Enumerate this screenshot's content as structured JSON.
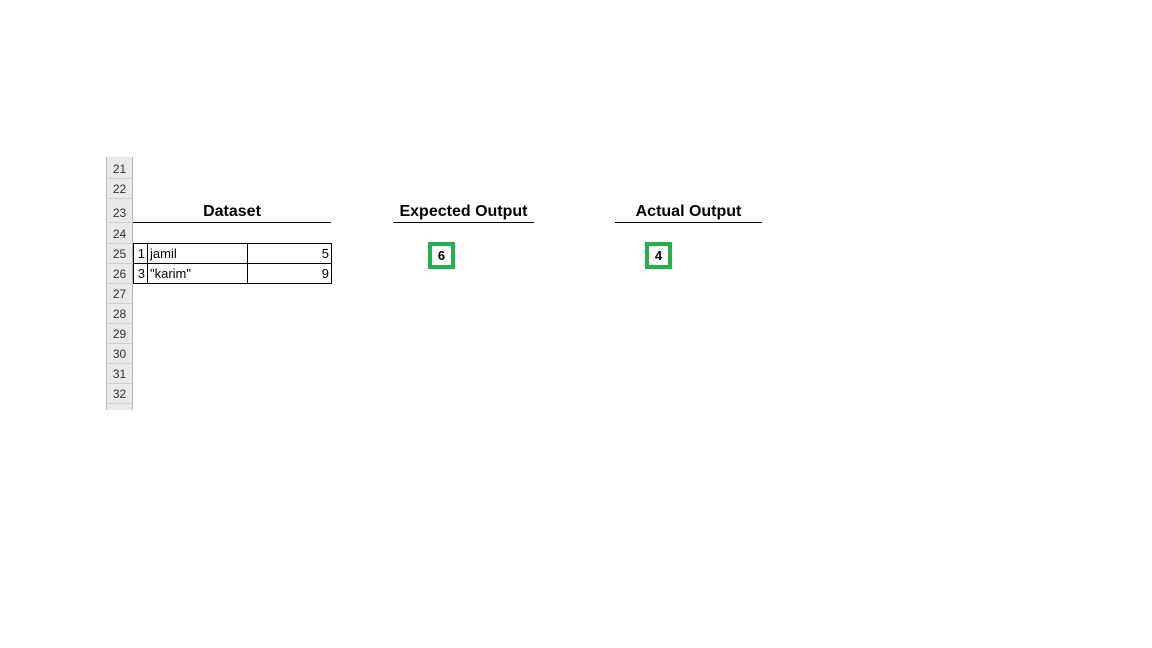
{
  "row_numbers": [
    "21",
    "22",
    "23",
    "24",
    "25",
    "26",
    "27",
    "28",
    "29",
    "30",
    "31",
    "32"
  ],
  "headings": {
    "dataset": "Dataset",
    "expected": "Expected Output",
    "actual": "Actual Output"
  },
  "dataset_rows": [
    {
      "index": "1",
      "name": "jamil",
      "value": "5"
    },
    {
      "index": "3",
      "name": "\"karim\"",
      "value": "9"
    }
  ],
  "expected_output": "6",
  "actual_output": "4",
  "colors": {
    "highlight_border": "#22b14c"
  }
}
